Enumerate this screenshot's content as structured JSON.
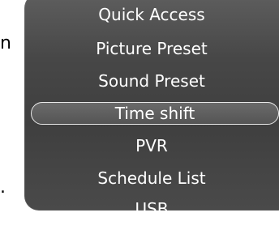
{
  "side_marks": {
    "top": "n",
    "bottom": "."
  },
  "menu": {
    "items": [
      {
        "label": "Quick Access"
      },
      {
        "label": "Picture Preset"
      },
      {
        "label": "Sound Preset"
      },
      {
        "label": "Time shift",
        "selected": true
      },
      {
        "label": "PVR"
      },
      {
        "label": "Schedule List"
      },
      {
        "label": "USB"
      }
    ]
  }
}
